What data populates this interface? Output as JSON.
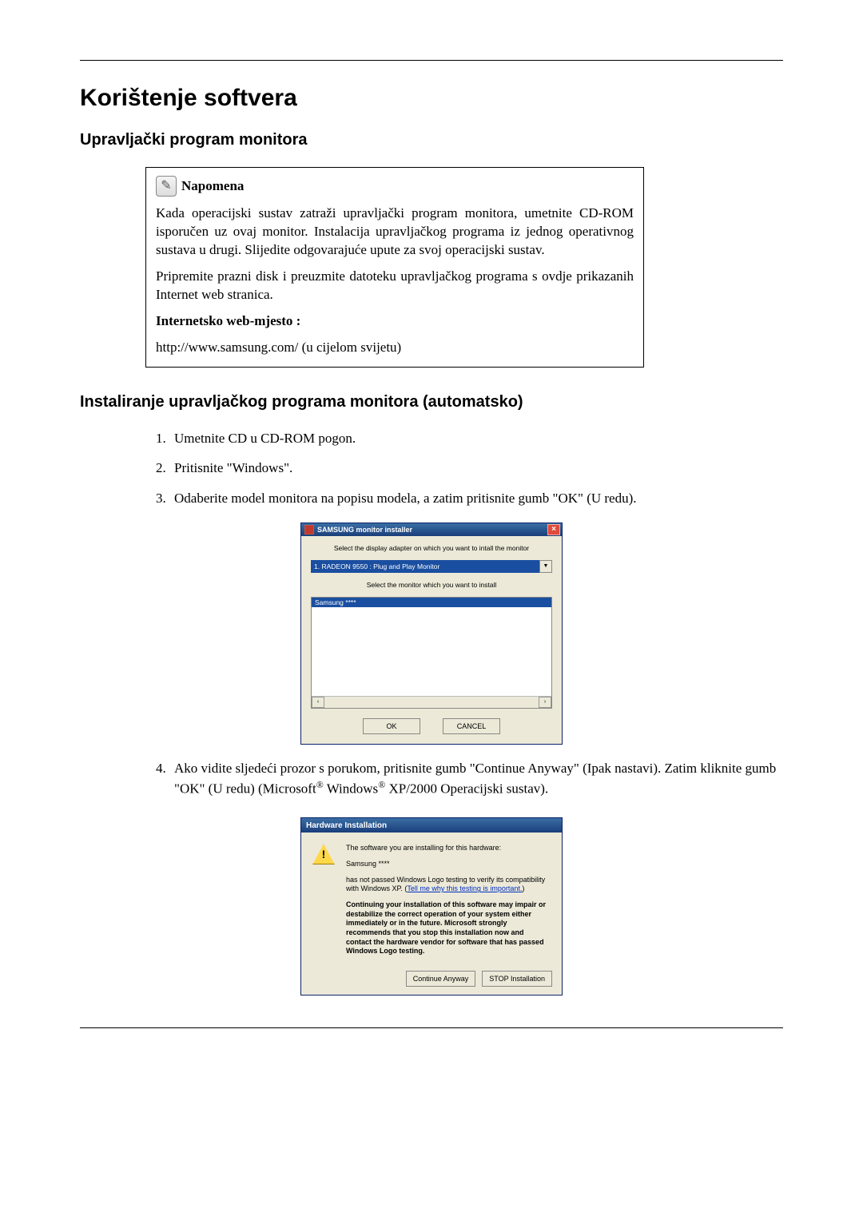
{
  "title": "Korištenje softvera",
  "section1": "Upravljački program monitora",
  "note": {
    "label": "Napomena",
    "p1": "Kada operacijski sustav zatraži upravljački program monitora, umetnite CD-ROM isporučen uz ovaj monitor. Instalacija upravljačkog programa iz jednog operativnog sustava u drugi. Slijedite odgovarajuće upute za svoj operacijski sustav.",
    "p2": "Pripremite prazni disk i preuzmite datoteku upravljačkog programa s ovdje prikazanih Internet web stranica.",
    "site_label": "Internetsko web-mjesto :",
    "url": "http://www.samsung.com/ (u cijelom svijetu)"
  },
  "section2": "Instaliranje upravljačkog programa monitora (automatsko)",
  "steps": {
    "s1": "Umetnite CD u CD-ROM pogon.",
    "s2": "Pritisnite \"Windows\".",
    "s3": "Odaberite model monitora na popisu modela, a zatim pritisnite gumb \"OK\" (U redu).",
    "s4_a": "Ako vidite sljedeći prozor s porukom, pritisnite gumb \"Continue Anyway\" (Ipak nastavi). Zatim kliknite gumb \"OK\" (U redu) (Microsoft",
    "s4_b": " Windows",
    "s4_c": " XP/2000 Operacijski sustav)."
  },
  "installer": {
    "title": "SAMSUNG monitor installer",
    "label1": "Select the display adapter on which you want to intall the monitor",
    "dropdown": "1. RADEON 9550 : Plug and Play Monitor",
    "label2": "Select the monitor which you want to install",
    "selected": "Samsung ****",
    "ok": "OK",
    "cancel": "CANCEL"
  },
  "hw": {
    "title": "Hardware Installation",
    "line1": "The software you are installing for this hardware:",
    "line2": "Samsung ****",
    "line3a": "has not passed Windows Logo testing to verify its compatibility with Windows XP. (",
    "link": "Tell me why this testing is important.",
    "line3b": ")",
    "warn": "Continuing your installation of this software may impair or destabilize the correct operation of your system either immediately or in the future. Microsoft strongly recommends that you stop this installation now and contact the hardware vendor for software that has passed Windows Logo testing.",
    "btn_continue": "Continue Anyway",
    "btn_stop": "STOP Installation"
  }
}
